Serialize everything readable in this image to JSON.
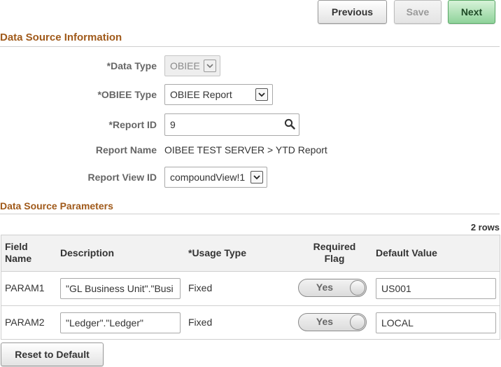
{
  "toolbar": {
    "previous_label": "Previous",
    "save_label": "Save",
    "next_label": "Next"
  },
  "data_source_info": {
    "title": "Data Source Information",
    "data_type_label": "*Data Type",
    "data_type_value": "OBIEE",
    "obiee_type_label": "*OBIEE Type",
    "obiee_type_value": "OBIEE Report",
    "report_id_label": "*Report ID",
    "report_id_value": "9",
    "report_name_label": "Report Name",
    "report_name_value": "OIBEE TEST SERVER > YTD Report",
    "report_view_label": "Report View ID",
    "report_view_value": "compoundView!1"
  },
  "params": {
    "title": "Data Source Parameters",
    "row_count": "2 rows",
    "headers": {
      "field_name": "Field Name",
      "description": "Description",
      "usage_type": "*Usage Type",
      "required_flag": "Required Flag",
      "default_value": "Default Value"
    },
    "rows": [
      {
        "field_name": "PARAM1",
        "description": "\"GL Business Unit\".\"Busi",
        "usage_type": "Fixed",
        "required": "Yes",
        "default_value": "US001"
      },
      {
        "field_name": "PARAM2",
        "description": "\"Ledger\".\"Ledger\"",
        "usage_type": "Fixed",
        "required": "Yes",
        "default_value": "LOCAL"
      }
    ],
    "reset_label": "Reset to Default"
  },
  "colors": {
    "section_title": "#a05a1b",
    "primary_button": "#8fd39a",
    "grid_header_bg": "#f2f2f2"
  }
}
